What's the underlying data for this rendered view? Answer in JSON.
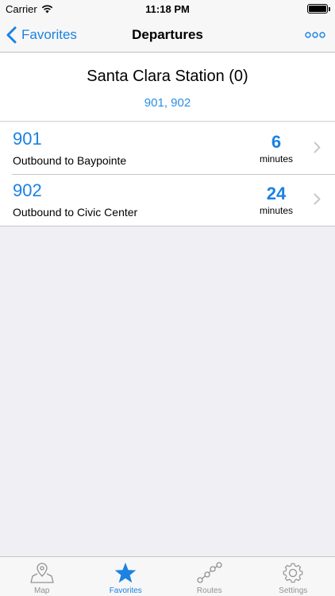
{
  "status_bar": {
    "carrier": "Carrier",
    "time": "11:18 PM"
  },
  "nav": {
    "back_label": "Favorites",
    "title": "Departures",
    "more_icon": "more-icon"
  },
  "stop": {
    "name": "Santa Clara Station (0)",
    "routes": "901, 902"
  },
  "departures": [
    {
      "route": "901",
      "destination": "Outbound to Baypointe",
      "minutes": "6",
      "unit": "minutes"
    },
    {
      "route": "902",
      "destination": "Outbound to Civic Center",
      "minutes": "24",
      "unit": "minutes"
    }
  ],
  "tabs": [
    {
      "label": "Map",
      "icon": "map-pin-icon",
      "active": false
    },
    {
      "label": "Favorites",
      "icon": "star-icon",
      "active": true
    },
    {
      "label": "Routes",
      "icon": "routes-icon",
      "active": false
    },
    {
      "label": "Settings",
      "icon": "gear-icon",
      "active": false
    }
  ],
  "colors": {
    "accent": "#1a82e2",
    "background": "#efeff4",
    "inactive": "#929292"
  }
}
